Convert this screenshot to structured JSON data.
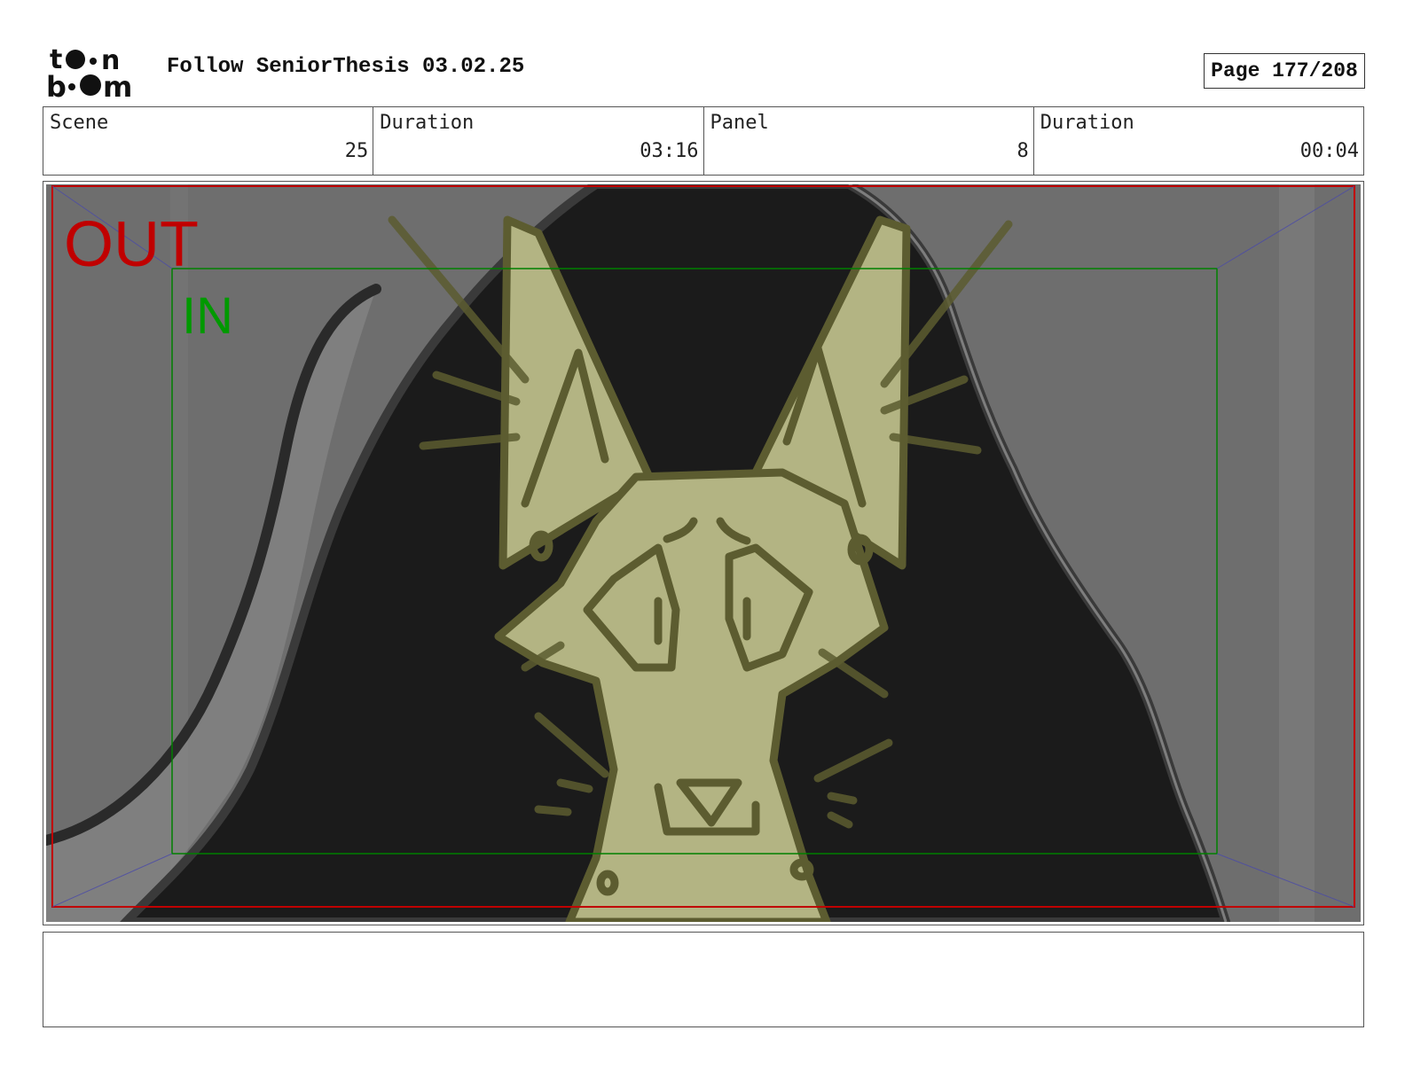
{
  "header": {
    "logo_text": "toon boom",
    "title": "Follow SeniorThesis 03.02.25",
    "page_label": "Page 177/208"
  },
  "info": {
    "scene_label": "Scene",
    "scene_value": "25",
    "scene_duration_label": "Duration",
    "scene_duration_value": "03:16",
    "panel_label": "Panel",
    "panel_value": "8",
    "panel_duration_label": "Duration",
    "panel_duration_value": "00:04"
  },
  "panel": {
    "out_label": "OUT",
    "in_label": "IN",
    "colors": {
      "out_frame": "#c00000",
      "in_frame": "#008000",
      "background_gray": "#6e6e6e",
      "shadow_dark": "#1b1b1b",
      "fox_fill": "#b3b483",
      "fox_line": "#5c5c30"
    }
  },
  "notes": {
    "text": ""
  }
}
